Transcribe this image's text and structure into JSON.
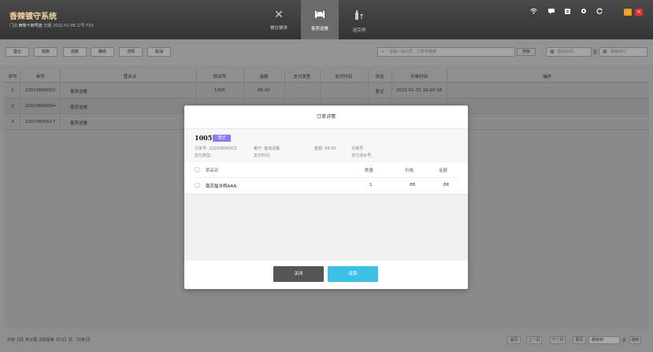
{
  "header": {
    "app_title": "香辣镀守系统",
    "store_label": "门店",
    "store_name": "西软十四号店",
    "date_label": "日期",
    "date": "2022-01-06",
    "worker_label": "工号",
    "worker": "FXX",
    "nav": [
      {
        "label": "餐位餐排",
        "icon": "utensils-icon",
        "active": false
      },
      {
        "label": "客房送餐",
        "icon": "bed-icon",
        "active": true
      },
      {
        "label": "送完吧",
        "icon": "bottle-icon",
        "active": false
      }
    ],
    "icons": [
      "wifi-icon",
      "message-icon",
      "clipboard-icon",
      "gear-icon",
      "refresh-icon"
    ]
  },
  "toolbar": {
    "buttons": [
      "登记",
      "结账",
      "挂账",
      "撤结",
      "详情",
      "取消"
    ],
    "search_placeholder": "请输入房间号，订单号搜索",
    "search_button": "搜索",
    "start_time_placeholder": "起始时间",
    "end_time_placeholder": "结束时间",
    "range_sep": "至"
  },
  "table": {
    "columns": [
      "序号",
      "单号",
      "营业点",
      "房间号",
      "金额",
      "支付类型",
      "支付时间",
      "状态",
      "开单时间",
      "操作"
    ],
    "rows": [
      {
        "no": "1",
        "order": "22010600003",
        "outlet": "客房送餐",
        "room": "1005",
        "amount": "88.00",
        "pay_type": "",
        "pay_time": "",
        "status": "登记",
        "open_time": "2022-01-31 16:20:16"
      },
      {
        "no": "2",
        "order": "22010600004",
        "outlet": "客房送餐",
        "room": "",
        "amount": "",
        "pay_type": "",
        "pay_time": "",
        "status": "",
        "open_time": ""
      },
      {
        "no": "3",
        "order": "22010600017",
        "outlet": "客房送餐",
        "room": "",
        "amount": "",
        "pay_type": "",
        "pay_time": "",
        "status": "",
        "open_time": ""
      }
    ]
  },
  "footer": {
    "summary": "共有【3】条记录,当前是第【1/1】页　15条/页",
    "first": "首页",
    "prev": "上一页",
    "next": "下一页",
    "last": "尾页",
    "goto_placeholder": "跳转到",
    "page_unit": "页",
    "jump": "跳转"
  },
  "modal": {
    "title": "订单详情",
    "table_no": "1005",
    "status": "登记",
    "order_no_label": "订单号:",
    "order_no": "22010600003",
    "restaurant_label": "餐厅:",
    "restaurant": "客房送餐",
    "amount_label": "金额:",
    "amount": "88.00",
    "trade_no_label": "交易号:",
    "trade_no": "",
    "pay_type_label": "支付类型:",
    "pay_type": "",
    "pay_time_label": "支付时间:",
    "pay_time": "",
    "serial_label": "支付流水号:",
    "serial": "",
    "item_columns": [
      "菜品名",
      "数量",
      "价格",
      "金额"
    ],
    "items": [
      {
        "name": "南京盐水鸭AAA",
        "qty": "1",
        "price": "88",
        "amount": "88"
      }
    ],
    "close_button": "关闭",
    "refund_button": "退菜"
  },
  "colors": {
    "header_bg": "#333333",
    "title_color": "#f5d6a0",
    "status_purple": "#8c7cf0",
    "close_btn": "#555555",
    "refund_btn": "#3ec1e6",
    "win_min": "#f0a020",
    "win_close": "#e03030"
  }
}
